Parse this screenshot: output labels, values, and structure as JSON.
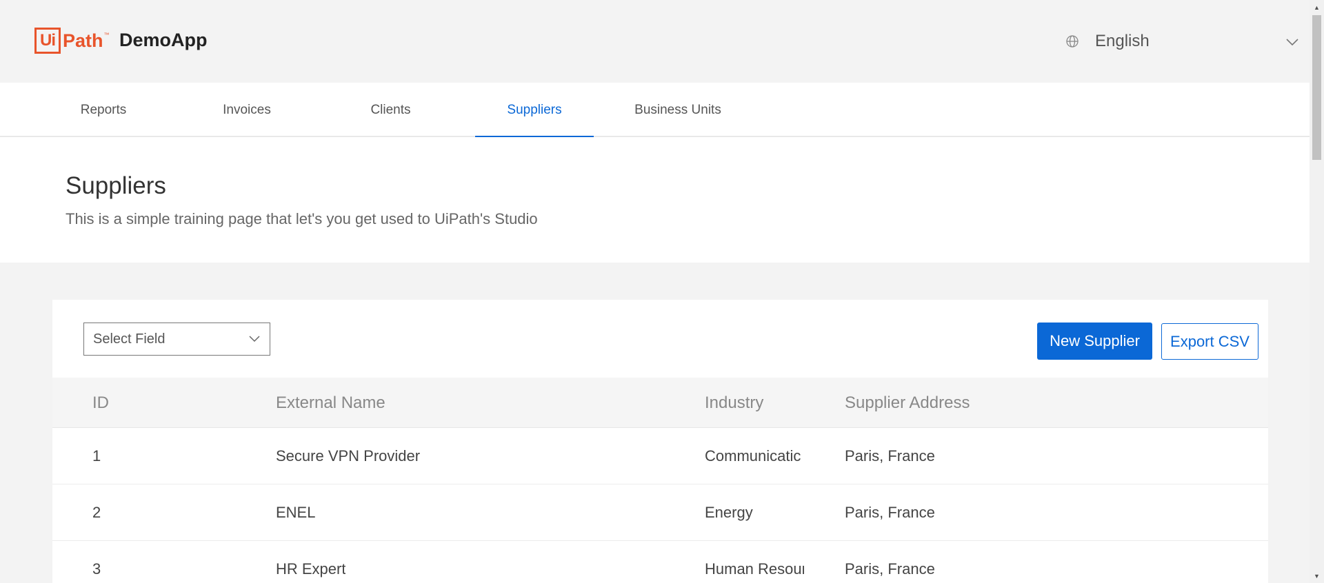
{
  "header": {
    "logo_mark": "Ui",
    "logo_text": "Path",
    "logo_tm": "™",
    "app_name": "DemoApp",
    "language": "English"
  },
  "tabs": [
    {
      "label": "Reports",
      "active": false
    },
    {
      "label": "Invoices",
      "active": false
    },
    {
      "label": "Clients",
      "active": false
    },
    {
      "label": "Suppliers",
      "active": true
    },
    {
      "label": "Business Units",
      "active": false
    }
  ],
  "page": {
    "title": "Suppliers",
    "subtitle": "This is a simple training page that let's you get used to UiPath's Studio"
  },
  "toolbar": {
    "select_placeholder": "Select Field",
    "new_label": "New Supplier",
    "export_label": "Export CSV"
  },
  "table": {
    "columns": [
      "ID",
      "External Name",
      "Industry",
      "Supplier Address"
    ],
    "rows": [
      [
        "1",
        "Secure VPN Provider",
        "Communicatic",
        "Paris, France"
      ],
      [
        "2",
        "ENEL",
        "Energy",
        "Paris, France"
      ],
      [
        "3",
        "HR Expert",
        "Human Resour",
        "Paris, France"
      ]
    ]
  },
  "colors": {
    "accent": "#0b68d6",
    "brand": "#e8542b"
  },
  "icons": {
    "globe": "globe-icon",
    "dropdown": "chevron-down-icon"
  }
}
